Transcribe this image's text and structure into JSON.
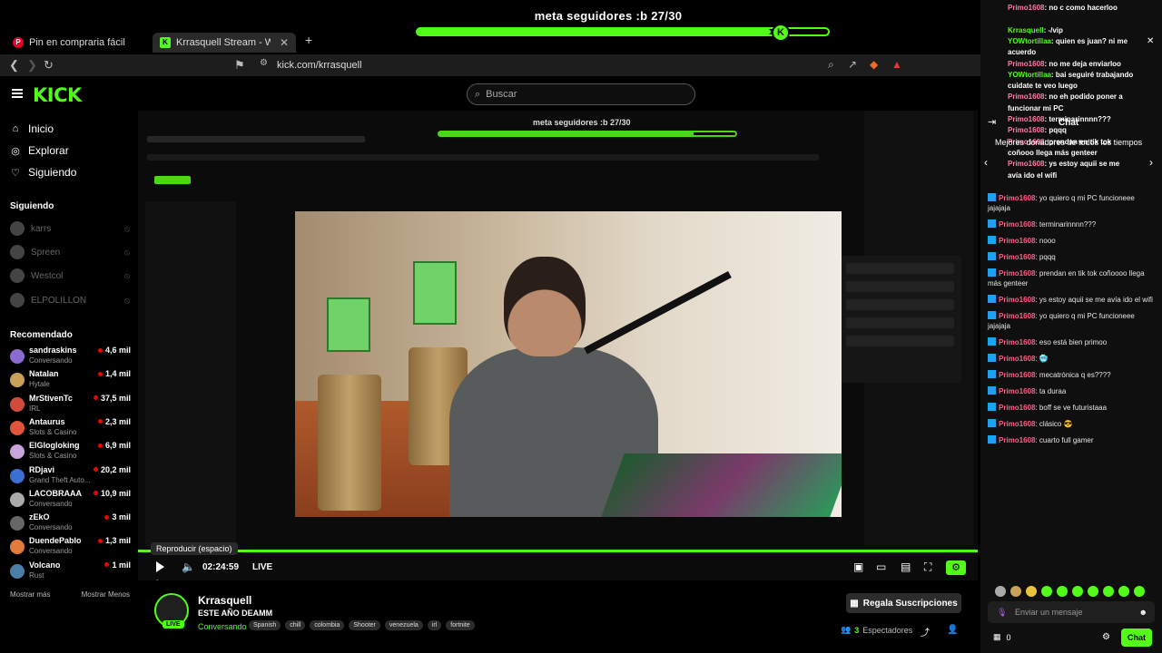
{
  "goal": {
    "text": "meta seguidores :b 27/30",
    "current": 27,
    "target": 30,
    "badge": "K"
  },
  "browser": {
    "tabs": [
      {
        "label": "Pin en compraria fácil",
        "icon": "pinterest-icon"
      },
      {
        "label": "Krrasquell Stream - Watch Live",
        "icon": "kick-icon",
        "close": "✕"
      }
    ],
    "new_tab": "+",
    "url": "kick.com/krrasquell"
  },
  "header": {
    "logo": "KICK",
    "search_placeholder": "Buscar"
  },
  "sidebar": {
    "nav": [
      {
        "label": "Inicio",
        "icon": "home-icon"
      },
      {
        "label": "Explorar",
        "icon": "compass-icon"
      },
      {
        "label": "Siguiendo",
        "icon": "heart-icon"
      }
    ],
    "following_title": "Siguiendo",
    "following": [
      "karrs",
      "Spreen",
      "Westcol",
      "ELPOLILLON"
    ],
    "recommended_title": "Recomendado",
    "recommended": [
      {
        "name": "sandraskins",
        "category": "Conversando",
        "viewers": "4,6 mil",
        "color": "#8a6bd1"
      },
      {
        "name": "Natalan",
        "category": "Hytale",
        "viewers": "1,4 mil",
        "color": "#c9a25a"
      },
      {
        "name": "MrStivenTc",
        "category": "IRL",
        "viewers": "37,5 mil",
        "color": "#d14b3b"
      },
      {
        "name": "Antaurus",
        "category": "Slots & Casino",
        "viewers": "2,3 mil",
        "color": "#e2553a"
      },
      {
        "name": "ElGlogloking",
        "category": "Slots & Casino",
        "viewers": "6,9 mil",
        "color": "#c7a4d9"
      },
      {
        "name": "RDjavi",
        "category": "Grand Theft Auto...",
        "viewers": "20,2 mil",
        "color": "#3b6fd1"
      },
      {
        "name": "LACOBRAAA",
        "category": "Conversando",
        "viewers": "10,9 mil",
        "color": "#aaa"
      },
      {
        "name": "zEkO",
        "category": "Conversando",
        "viewers": "3 mil",
        "color": "#666"
      },
      {
        "name": "DuendePablo",
        "category": "Conversando",
        "viewers": "1,3 mil",
        "color": "#e27c3a"
      },
      {
        "name": "Volcano",
        "category": "Rust",
        "viewers": "1 mil",
        "color": "#4a7ea8"
      }
    ],
    "show_more": "Mostrar más",
    "show_less": "Mostrar Menos"
  },
  "player": {
    "tooltip": "Reproducir (espacio)",
    "time": "02:24:59",
    "live": "LIVE"
  },
  "stream": {
    "streamer": "Krrasquell",
    "title": "ESTE AÑO DEAMM",
    "category": "Conversando",
    "live_badge": "LIVE",
    "tags": [
      "Spanish",
      "chill",
      "colombia",
      "Shooter",
      "venezuela",
      "irl",
      "fortnite"
    ],
    "subscribe_label": "Regala Suscripciones",
    "viewers": "3",
    "viewers_label": "Espectadores"
  },
  "chat": {
    "overlay": [
      {
        "user": "Primo1608",
        "text": ": no c como hacerloo"
      },
      {
        "user": "",
        "text": ""
      },
      {
        "user": "Krrasquell",
        "text": ": -/vip"
      },
      {
        "user": "YOWtortillaa",
        "text": ": quien es juan? ni me"
      },
      {
        "user": "",
        "text": "acuerdo"
      },
      {
        "user": "Primo1608",
        "text": ": no me deja enviarloo"
      },
      {
        "user": "YOWtortillaa",
        "text": ": bai seguiré trabajando"
      },
      {
        "user": "",
        "text": "cuidate te veo luego"
      },
      {
        "user": "Primo1608",
        "text": ": no eh podido poner a"
      },
      {
        "user": "",
        "text": "funcionar mi PC"
      },
      {
        "user": "Primo1608",
        "text": ": terminarinnnn???"
      },
      {
        "user": "Primo1608",
        "text": ": pqqq"
      },
      {
        "user": "Primo1608",
        "text": ": prendan en tik tok"
      },
      {
        "user": "",
        "text": "coñooo llega más genteer"
      },
      {
        "user": "Primo1608",
        "text": ": ys estoy aquii se me"
      },
      {
        "user": "",
        "text": "avía ido el wifi"
      }
    ],
    "title": "Chat",
    "top_donors": "Mejores donadores de todos los tiempos",
    "messages": [
      {
        "user": "Primo1608",
        "text": ": yo quiero q mi PC funcioneee jajajaja"
      },
      {
        "user": "Primo1608",
        "text": ": terminarinnnn???"
      },
      {
        "user": "Primo1608",
        "text": ": nooo"
      },
      {
        "user": "Primo1608",
        "text": ": pqqq"
      },
      {
        "user": "Primo1608",
        "text": ": prendan en tik tok coñoooo llega más genteer"
      },
      {
        "user": "Primo1608",
        "text": ": ys estoy aquii se me avía ido el wifi"
      },
      {
        "user": "Primo1608",
        "text": ": yo quiero q mi PC funcioneee jajajaja"
      },
      {
        "user": "Primo1608",
        "text": ": eso está bien primoo"
      },
      {
        "user": "Primo1608",
        "text": ": 🥶"
      },
      {
        "user": "Primo1608",
        "text": ": mecatrónica q es????"
      },
      {
        "user": "Primo1608",
        "text": ": ta duraa"
      },
      {
        "user": "Primo1608",
        "text": ": boff se ve futuristaaa"
      },
      {
        "user": "Primo1608",
        "text": ": clásico 😎"
      },
      {
        "user": "Primo1608",
        "text": ": cuarto full gamer"
      }
    ],
    "input_placeholder": "Enviar un mensaje",
    "kicks": "0",
    "send_label": "Chat"
  },
  "colors": {
    "accent": "#53fc18",
    "background": "#000000",
    "chat_user": "#ff5f88"
  }
}
